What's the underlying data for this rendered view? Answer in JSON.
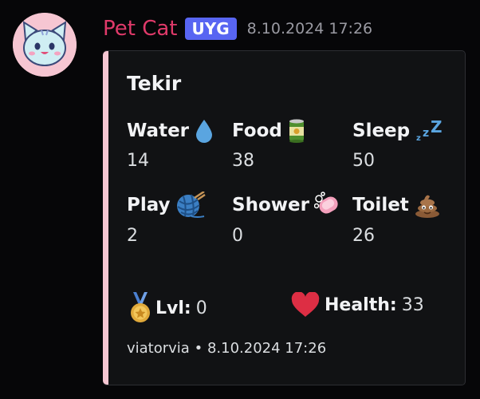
{
  "message": {
    "username": "Pet Cat",
    "tag": "UYG",
    "timestamp": "8.10.2024 17:26",
    "username_color": "#e03a6a",
    "tag_color": "#5865f2"
  },
  "embed": {
    "accent_color": "#f6c6d2",
    "title": "Tekir",
    "stats": [
      {
        "name": "Water",
        "icon": "water-drop-icon",
        "value": "14"
      },
      {
        "name": "Food",
        "icon": "food-can-icon",
        "value": "38"
      },
      {
        "name": "Sleep",
        "icon": "zzz-icon",
        "value": "50"
      },
      {
        "name": "Play",
        "icon": "yarn-ball-icon",
        "value": "2"
      },
      {
        "name": "Shower",
        "icon": "soap-icon",
        "value": "0"
      },
      {
        "name": "Toilet",
        "icon": "poop-icon",
        "value": "26"
      }
    ],
    "level": {
      "icon": "medal-icon",
      "label": "Lvl:",
      "value": "0"
    },
    "health": {
      "icon": "heart-icon",
      "label": "Health:",
      "value": "33"
    },
    "footer": {
      "author": "viatorvia",
      "separator": "•",
      "time": "8.10.2024 17:26"
    }
  }
}
